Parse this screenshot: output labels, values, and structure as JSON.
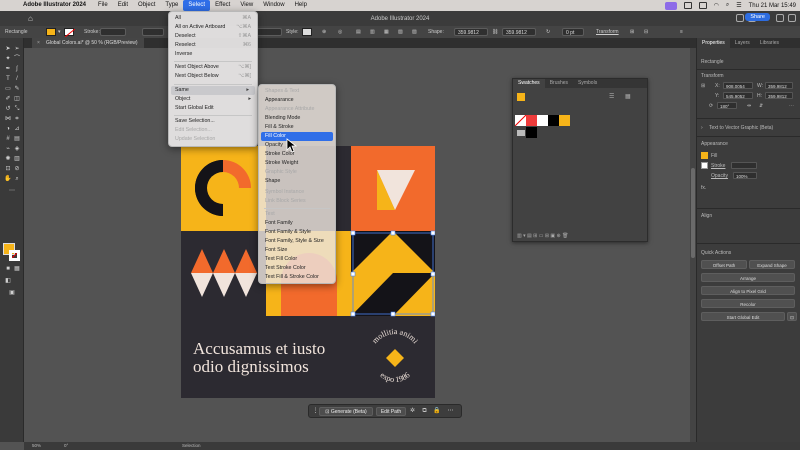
{
  "menubar": {
    "app_name": "Adobe Illustrator 2024",
    "items": [
      "File",
      "Edit",
      "Object",
      "Type",
      "Select",
      "Effect",
      "View",
      "Window",
      "Help"
    ],
    "active_item": "Select",
    "clock": "Thu 21 Mar  15:49"
  },
  "titlebar": {
    "title": "Adobe Illustrator 2024",
    "share_label": "Share"
  },
  "controlbar": {
    "selection_label": "Rectangle",
    "stroke_label": "Stroke:",
    "style_label": "Style:",
    "shape_label": "Shape:",
    "width_value": "359.9812 pt",
    "height_value": "359.9812 pt",
    "corner_value": "0 pt",
    "transform_label": "Transform",
    "fill_color": "#f6b419"
  },
  "document": {
    "tab_label": "Global Colors.ai* @ 50 % (RGB/Preview)"
  },
  "select_menu": {
    "items": [
      {
        "label": "All",
        "shortcut": "⌘A"
      },
      {
        "label": "All on Active Artboard",
        "shortcut": "⌥⌘A"
      },
      {
        "label": "Deselect",
        "shortcut": "⇧⌘A"
      },
      {
        "label": "Reselect",
        "shortcut": "⌘6"
      },
      {
        "label": "Inverse",
        "shortcut": ""
      },
      {
        "label": "Next Object Above",
        "shortcut": "⌥⌘]"
      },
      {
        "label": "Next Object Below",
        "shortcut": "⌥⌘["
      },
      {
        "label": "Same",
        "shortcut": "▸"
      },
      {
        "label": "Object",
        "shortcut": "▸"
      },
      {
        "label": "Start Global Edit",
        "shortcut": ""
      },
      {
        "label": "Save Selection...",
        "shortcut": ""
      },
      {
        "label": "Edit Selection...",
        "shortcut": ""
      },
      {
        "label": "Update Selection",
        "shortcut": ""
      }
    ]
  },
  "same_submenu": {
    "header_shapes": "Shapes & Text",
    "header_text": "Text",
    "items": [
      "Appearance",
      "Appearance Attribute",
      "Blending Mode",
      "Fill & Stroke",
      "Fill Color",
      "Opacity",
      "Stroke Color",
      "Stroke Weight",
      "Graphic Style",
      "Shape",
      "Symbol Instance",
      "Link Block Series",
      "Font Family",
      "Font Family & Style",
      "Font Family, Style & Size",
      "Font Size",
      "Text Fill Color",
      "Text Stroke Color",
      "Text Fill & Stroke Color"
    ]
  },
  "swatches_panel": {
    "tabs": [
      "Swatches",
      "Brushes",
      "Symbols"
    ]
  },
  "right_panel": {
    "tabs": [
      "Properties",
      "Layers",
      "Libraries"
    ],
    "selection": "Rectangle",
    "transform_label": "Transform",
    "x_value": "908.0054",
    "y_value": "545.9052",
    "w_value": "359.9812",
    "h_value": "359.9812",
    "rotate_value": "180°",
    "text_to_vector": "Text to Vector Graphic (Beta)",
    "appearance_label": "Appearance",
    "fill_label": "Fill",
    "stroke_label": "Stroke",
    "opacity_label": "Opacity",
    "opacity_value": "100%",
    "fx_label": "fx.",
    "align_label": "Align",
    "quick_actions_label": "Quick Actions",
    "offset_path": "Offset Path",
    "expand_shape": "Expand Shape",
    "arrange": "Arrange",
    "align_pixel": "Align to Pixel Grid",
    "recolor": "Recolor",
    "start_global_edit": "Start Global Edit"
  },
  "artboard": {
    "headline_line1": "Accusamus et iusto",
    "headline_line2": "odio dignissimos",
    "badge_top": "mollitia animi",
    "badge_bottom": "expo 1986",
    "colors": {
      "orange": "#f26a2c",
      "yellow": "#f6b419",
      "dark": "#2c2a31",
      "cream": "#f1e4dc",
      "black": "#141318"
    }
  },
  "contextbar": {
    "generate_label": "Generate (Beta)",
    "edit_path_label": "Edit Path"
  },
  "statusbar": {
    "zoom": "50%",
    "rotation": "0°",
    "mode": "Selection"
  }
}
